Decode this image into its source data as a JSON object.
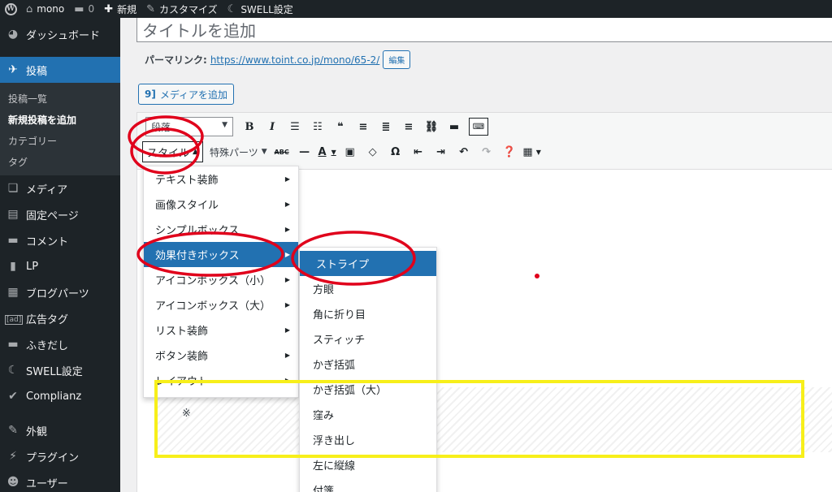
{
  "adminbar": {
    "site_name": "mono",
    "comments_count": "0",
    "new_label": "新規",
    "customize_label": "カスタマイズ",
    "swell_label": "SWELL設定"
  },
  "sidebar": {
    "items": [
      {
        "label": "ダッシュボード",
        "icon": "dashboard-icon"
      },
      {
        "label": "投稿",
        "icon": "pin-icon"
      },
      {
        "label": "メディア",
        "icon": "media-icon"
      },
      {
        "label": "固定ページ",
        "icon": "page-icon"
      },
      {
        "label": "コメント",
        "icon": "comment-icon"
      },
      {
        "label": "LP",
        "icon": "document-icon"
      },
      {
        "label": "ブログパーツ",
        "icon": "grid-icon"
      },
      {
        "label": "広告タグ",
        "icon": "ad-icon"
      },
      {
        "label": "ふきだし",
        "icon": "speech-icon"
      },
      {
        "label": "SWELL設定",
        "icon": "swell-icon"
      },
      {
        "label": "Complianz",
        "icon": "check-icon"
      },
      {
        "label": "外観",
        "icon": "brush-icon"
      },
      {
        "label": "プラグイン",
        "icon": "plugin-icon"
      },
      {
        "label": "ユーザー",
        "icon": "user-icon"
      }
    ],
    "ad_icon_text": "[ad]",
    "submenu": [
      "投稿一覧",
      "新規投稿を追加",
      "カテゴリー",
      "タグ"
    ]
  },
  "main": {
    "title_placeholder": "タイトルを追加",
    "permalink_label": "パーマリンク:",
    "permalink_url": "https://www.toint.co.jp/mono/65-2/",
    "edit_button": "編集",
    "media_button": "メディアを追加",
    "media_icon_text": "9]"
  },
  "toolbar": {
    "format_select": "段落",
    "style_button": "スタイル",
    "special_parts": "特殊パーツ",
    "strike_label": "ABC",
    "text_color_label": "A"
  },
  "menu1": {
    "items": [
      "テキスト装飾",
      "画像スタイル",
      "シンプルボックス",
      "効果付きボックス",
      "アイコンボックス（小）",
      "アイコンボックス（大）",
      "リスト装飾",
      "ボタン装飾",
      "レイアウト"
    ],
    "highlighted": 3
  },
  "menu2": {
    "items": [
      "ストライプ",
      "方眼",
      "角に折り目",
      "スティッチ",
      "かぎ括弧",
      "かぎ括弧（大）",
      "窪み",
      "浮き出し",
      "左に縦線",
      "付箋"
    ],
    "highlighted": 0
  },
  "content": {
    "note_mark": "※"
  },
  "annotations": {
    "red": "#e0001b",
    "yellow": "#f7ef1a"
  }
}
